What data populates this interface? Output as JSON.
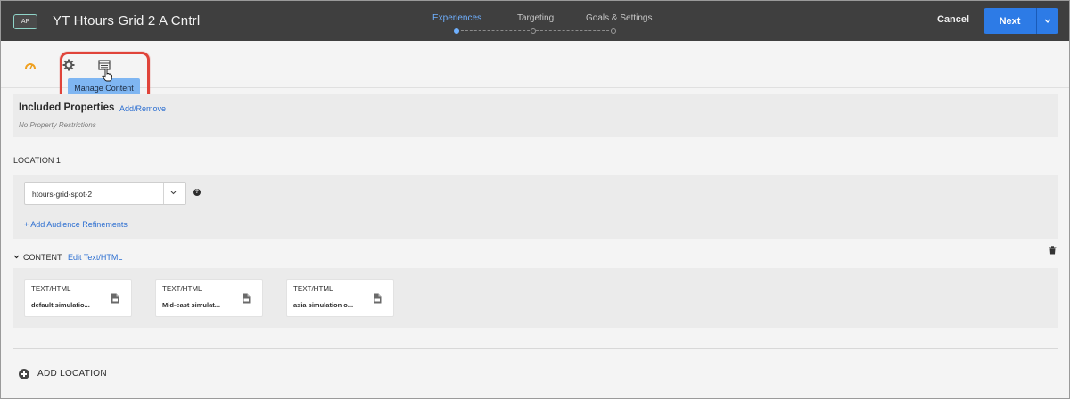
{
  "header": {
    "badge": "AP",
    "title": "YT Htours Grid 2 A Cntrl",
    "steps": [
      {
        "label": "Experiences",
        "active": true
      },
      {
        "label": "Targeting",
        "active": false
      },
      {
        "label": "Goals & Settings",
        "active": false
      }
    ],
    "cancel_label": "Cancel",
    "next_label": "Next"
  },
  "toolbar": {
    "tooltip": "Manage Content",
    "icons": [
      "analytics-icon",
      "settings-gear-icon",
      "manage-content-icon"
    ]
  },
  "properties": {
    "title": "Included Properties",
    "link": "Add/Remove",
    "note": "No Property Restrictions"
  },
  "location": {
    "label": "LOCATION 1",
    "selected": "htours-grid-spot-2",
    "help": "?",
    "audience_link": "+  Add Audience Refinements"
  },
  "content": {
    "label": "CONTENT",
    "edit_link": "Edit Text/HTML",
    "cards": [
      {
        "type": "TEXT/HTML",
        "name": "default simulatio..."
      },
      {
        "type": "TEXT/HTML",
        "name": "Mid-east simulat..."
      },
      {
        "type": "TEXT/HTML",
        "name": "asia simulation o..."
      }
    ]
  },
  "add_location": "ADD LOCATION",
  "colors": {
    "header_bg": "#3f3f3f",
    "accent_blue": "#2d7be6",
    "link_blue": "#2d6fd1",
    "highlight_red": "#e0443a"
  }
}
